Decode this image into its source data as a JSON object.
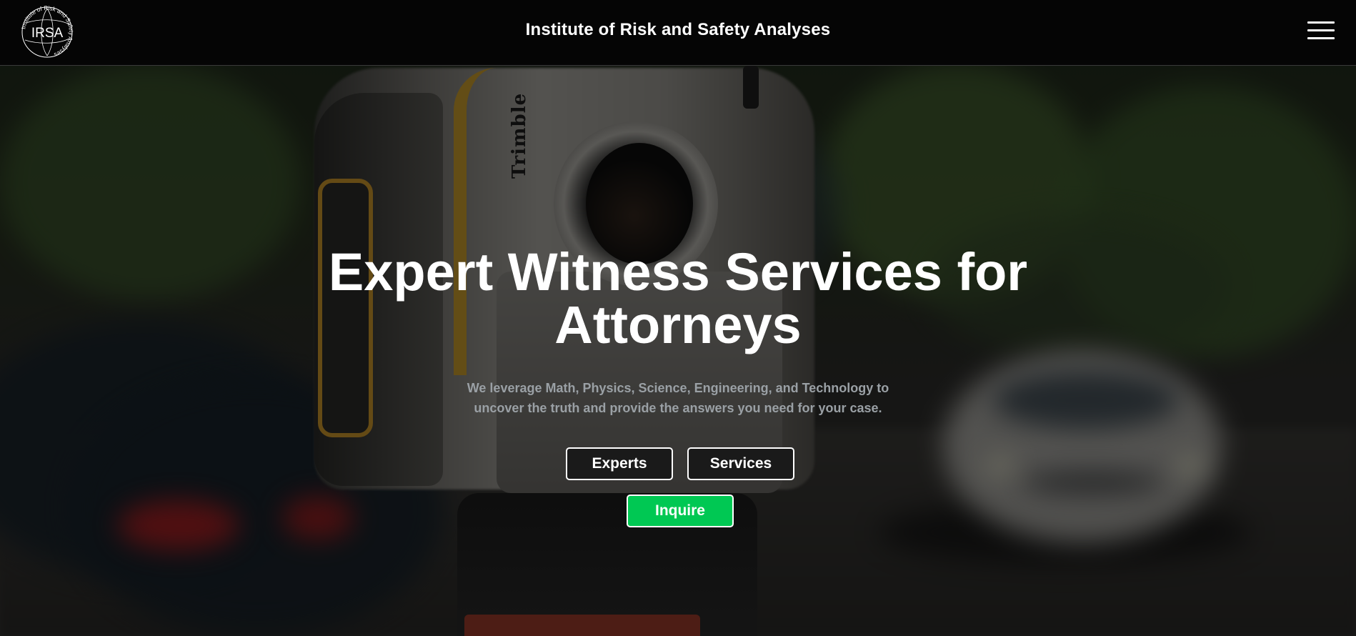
{
  "header": {
    "logo_text": "IRSA",
    "logo_ring_text": "Institute of Risk and Safety Analyses",
    "title": "Institute of Risk and Safety Analyses",
    "menu_icon": "hamburger-menu-icon"
  },
  "hero": {
    "background_brand_text": "Trimble",
    "title": "Expert Witness Services for Attorneys",
    "subtitle_line1": "We leverage Math, Physics, Science, Engineering, and Technology to",
    "subtitle_line2": "uncover the truth and provide the answers you need for your case.",
    "buttons": {
      "experts": "Experts",
      "services": "Services",
      "inquire": "Inquire"
    }
  },
  "colors": {
    "header_bg": "#050505",
    "inquire_accent": "#00c853",
    "subtitle_text": "#9aa0a5"
  }
}
